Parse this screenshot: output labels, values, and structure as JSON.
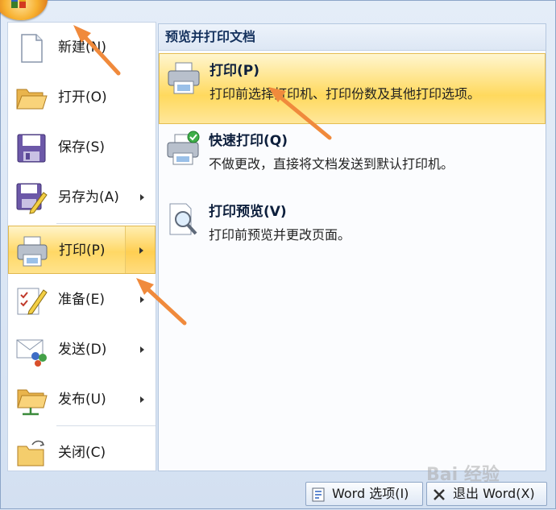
{
  "left_menu": {
    "items": [
      {
        "label": "新建(N)",
        "icon": "new-document-icon",
        "submenu": false
      },
      {
        "label": "打开(O)",
        "icon": "open-folder-icon",
        "submenu": false
      },
      {
        "label": "保存(S)",
        "icon": "save-disk-icon",
        "submenu": false
      },
      {
        "label": "另存为(A)",
        "icon": "save-as-icon",
        "submenu": true
      },
      {
        "label": "打印(P)",
        "icon": "printer-icon",
        "submenu": true,
        "active": true
      },
      {
        "label": "准备(E)",
        "icon": "prepare-icon",
        "submenu": true
      },
      {
        "label": "发送(D)",
        "icon": "send-icon",
        "submenu": true
      },
      {
        "label": "发布(U)",
        "icon": "publish-icon",
        "submenu": true
      },
      {
        "label": "关闭(C)",
        "icon": "close-folder-icon",
        "submenu": false
      }
    ]
  },
  "right_panel": {
    "header": "预览并打印文档",
    "options": [
      {
        "title": "打印(P)",
        "description": "打印前选择打印机、打印份数及其他打印选项。",
        "icon": "printer-icon"
      },
      {
        "title": "快速打印(Q)",
        "description": "不做更改，直接将文档发送到默认打印机。",
        "icon": "quick-print-icon"
      },
      {
        "title": "打印预览(V)",
        "description": "打印前预览并更改页面。",
        "icon": "print-preview-icon"
      }
    ]
  },
  "footer": {
    "word_options": "Word 选项(I)",
    "exit_word": "退出 Word(X)"
  },
  "watermark": "Bai 经验",
  "colors": {
    "highlight": "#ffd865",
    "annotation_arrow": "#f08a3c",
    "header_text": "#15325e"
  }
}
